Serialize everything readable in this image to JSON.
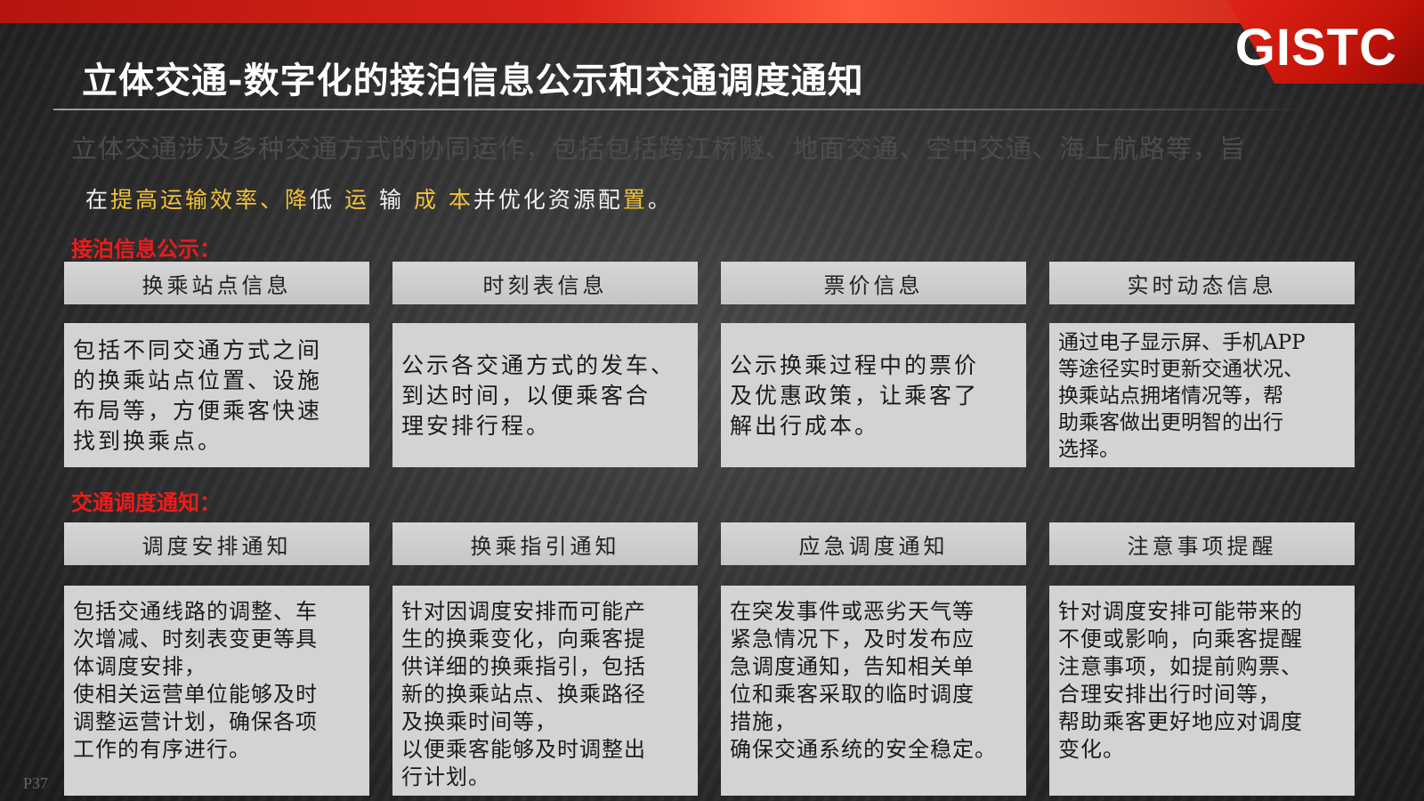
{
  "slide": {
    "logo": "GISTC",
    "title": "立体交通-数字化的接泊信息公示和交通调度通知",
    "intro_line1": "立体交通涉及多种交通方式的协同运作，包括包括跨江桥隧、地面交通、空中交通、海上航路等，旨",
    "intro_line2": {
      "p1": "在",
      "h1": "提高运输效率、降",
      "p2": "低",
      "h2": "运",
      "p3": "输",
      "h3": "成 本",
      "p4": "并优化资源配",
      "h4": "置",
      "p5": "。"
    },
    "section1_label": "接泊信息公示：",
    "section2_label": "交通调度通知：",
    "section1_cards": [
      {
        "title": "换乘站点信息",
        "body": "包括不同交通方式之间\n的换乘站点位置、设施\n布局等，方便乘客快速\n找到换乘点。"
      },
      {
        "title": "时刻表信息",
        "body": "公示各交通方式的发车、\n到达时间，以便乘客合\n理安排行程。"
      },
      {
        "title": "票价信息",
        "body": "公示换乘过程中的票价\n及优惠政策，让乘客了\n解出行成本。"
      },
      {
        "title": "实时动态信息",
        "body": "通过电子显示屏、手机APP\n等途径实时更新交通状况、\n换乘站点拥堵情况等，帮\n助乘客做出更明智的出行\n选择。"
      }
    ],
    "section2_cards": [
      {
        "title": "调度安排通知",
        "body": "包括交通线路的调整、车\n次增减、时刻表变更等具\n体调度安排，\n使相关运营单位能够及时\n调整运营计划，确保各项\n工作的有序进行。"
      },
      {
        "title": "换乘指引通知",
        "body": "针对因调度安排而可能产\n生的换乘变化，向乘客提\n供详细的换乘指引，包括\n新的换乘站点、换乘路径\n及换乘时间等，\n以便乘客能够及时调整出\n行计划。"
      },
      {
        "title": "应急调度通知",
        "body": "在突发事件或恶劣天气等\n紧急情况下，及时发布应\n急调度通知，告知相关单\n位和乘客采取的临时调度\n措施，\n确保交通系统的安全稳定。"
      },
      {
        "title": "注意事项提醒",
        "body": "针对调度安排可能带来的\n不便或影响，向乘客提醒\n注意事项，如提前购票、\n合理安排出行时间等，\n帮助乘客更好地应对调度\n变化。"
      }
    ],
    "page_number": "P37",
    "colors": {
      "accent_red": "#ee1b1b",
      "highlight_gold": "#f2c13c",
      "card_gray": "#d3d3d3"
    }
  }
}
